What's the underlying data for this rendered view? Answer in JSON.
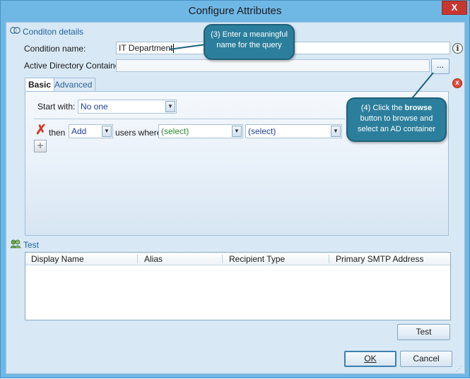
{
  "window": {
    "title": "Configure Attributes",
    "close_glyph": "X"
  },
  "condition_details": {
    "header": "Conditon details",
    "icon": "condition-details-icon",
    "condition_name_label": "Condition name:",
    "condition_name_value": "IT Department",
    "ad_container_label": "Active Directory Container:",
    "ad_container_value": "",
    "browse_label": "...",
    "info_glyph": "i",
    "remove_glyph": "x"
  },
  "tabs": [
    {
      "label": "Basic",
      "active": true
    },
    {
      "label": "Advanced",
      "active": false
    }
  ],
  "basic": {
    "start_with_label": "Start with:",
    "start_with_value": "No one",
    "rule": {
      "then_label": "then",
      "action_value": "Add",
      "users_where_label": "users where",
      "attribute_value": "(select)",
      "operator_value": "(select)"
    },
    "add_rule_glyph": "+",
    "remove_rule_glyph": "✗"
  },
  "test": {
    "header": "Test",
    "icon": "test-users-icon",
    "columns": [
      "Display Name",
      "Alias",
      "Recipient Type",
      "Primary SMTP Address"
    ],
    "rows": [],
    "test_button": "Test"
  },
  "footer": {
    "ok_label": "OK",
    "cancel_label": "Cancel"
  },
  "callouts": {
    "step3": "(3) Enter a meaningful name for the query",
    "step4_prefix": "(4) Click the",
    "step4_bold": "browse",
    "step4_suffix": "button to browse and select an AD container"
  },
  "colors": {
    "window_frame": "#6fb8e6",
    "client_bg": "#d8e8f5",
    "callout_bg": "#2c7f9c",
    "link_blue": "#1f5f9c",
    "remove_red": "#d23a2a"
  }
}
